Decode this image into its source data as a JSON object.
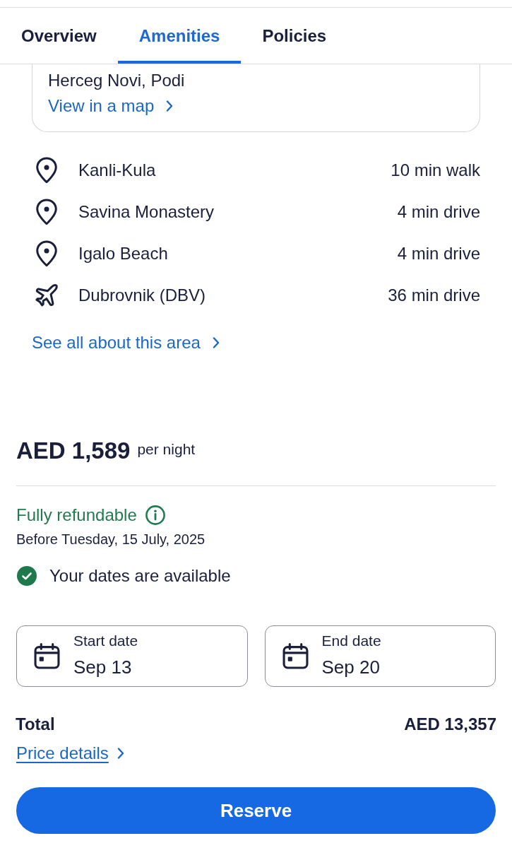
{
  "tabs": [
    {
      "label": "Overview",
      "selected": false
    },
    {
      "label": "Amenities",
      "selected": true
    },
    {
      "label": "Policies",
      "selected": false
    }
  ],
  "location_card": {
    "address": "Herceg Novi, Podi",
    "map_link": "View in a map"
  },
  "nearby": [
    {
      "kind": "place",
      "name": "Kanli-Kula",
      "distance": "10 min walk"
    },
    {
      "kind": "place",
      "name": "Savina Monastery",
      "distance": "4 min drive"
    },
    {
      "kind": "place",
      "name": "Igalo Beach",
      "distance": "4 min drive"
    },
    {
      "kind": "airport",
      "name": "Dubrovnik (DBV)",
      "distance": "36 min drive"
    }
  ],
  "area_link": "See all about this area",
  "price": {
    "amount": "AED 1,589",
    "unit": "per night"
  },
  "refund": {
    "label": "Fully refundable",
    "deadline": "Before Tuesday, 15 July, 2025"
  },
  "availability": {
    "text": "Your dates are available"
  },
  "dates": [
    {
      "label": "Start date",
      "value": "Sep 13"
    },
    {
      "label": "End date",
      "value": "Sep 20"
    }
  ],
  "total": {
    "label": "Total",
    "amount": "AED 13,357"
  },
  "price_details_link": "Price details",
  "reserve_button": "Reserve"
}
